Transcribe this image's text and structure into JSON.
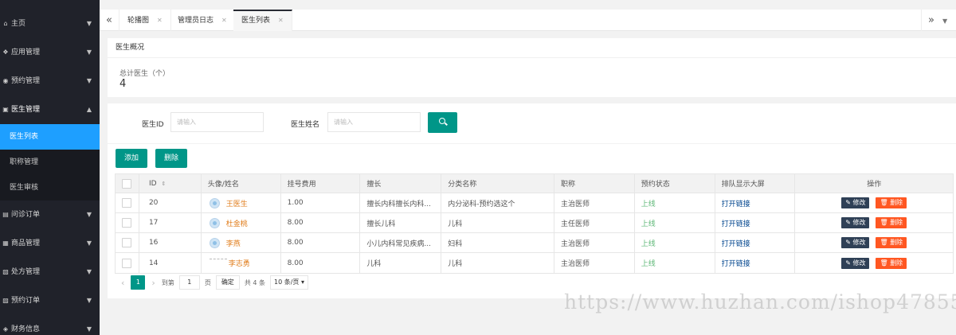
{
  "sidebar": {
    "items": [
      {
        "label": "主页",
        "icon": "home-icon",
        "glyph": "⌂"
      },
      {
        "label": "应用管理",
        "icon": "app-icon",
        "glyph": "❖"
      },
      {
        "label": "预约管理",
        "icon": "calendar-icon",
        "glyph": "◉"
      },
      {
        "label": "医生管理",
        "icon": "users-icon",
        "glyph": "▣"
      }
    ],
    "subitems": [
      {
        "label": "医生列表"
      },
      {
        "label": "职称管理"
      },
      {
        "label": "医生审核"
      }
    ],
    "items_after": [
      {
        "label": "问诊订单",
        "icon": "chat-icon",
        "glyph": "▤"
      },
      {
        "label": "商品管理",
        "icon": "goods-icon",
        "glyph": "▦"
      },
      {
        "label": "处方管理",
        "icon": "prescription-icon",
        "glyph": "▧"
      },
      {
        "label": "预约订单",
        "icon": "order-icon",
        "glyph": "▨"
      },
      {
        "label": "财务信息",
        "icon": "finance-icon",
        "glyph": "◈"
      }
    ]
  },
  "tabs": [
    {
      "label": "轮播图"
    },
    {
      "label": "管理员日志"
    },
    {
      "label": "医生列表"
    }
  ],
  "overview": {
    "title": "医生概况",
    "stat_label": "总计医生（个）",
    "stat_value": "4"
  },
  "search": {
    "id_label": "医生ID",
    "id_placeholder": "请输入",
    "name_label": "医生姓名",
    "name_placeholder": "请输入"
  },
  "toolbar": {
    "add_label": "添加",
    "delete_label": "删除"
  },
  "table": {
    "columns": [
      "ID",
      "头像/姓名",
      "挂号费用",
      "擅长",
      "分类名称",
      "职称",
      "预约状态",
      "排队显示大屏",
      "操作"
    ],
    "rows": [
      {
        "id": "20",
        "name": "王医生",
        "fee": "1.00",
        "specialty": "擅长内科擅长内科...",
        "category": "内分泌科-预约选这个",
        "title": "主治医师",
        "status": "上线",
        "link": "打开链接",
        "avatar": true
      },
      {
        "id": "17",
        "name": "杜金桃",
        "fee": "8.00",
        "specialty": "擅长儿科",
        "category": "儿科",
        "title": "主任医师",
        "status": "上线",
        "link": "打开链接",
        "avatar": true
      },
      {
        "id": "16",
        "name": "李燕",
        "fee": "8.00",
        "specialty": "小儿内科常见疾病...",
        "category": "妇科",
        "title": "主治医师",
        "status": "上线",
        "link": "打开链接",
        "avatar": true
      },
      {
        "id": "14",
        "name": "李志勇",
        "fee": "8.00",
        "specialty": "儿科",
        "category": "儿科",
        "title": "主治医师",
        "status": "上线",
        "link": "打开链接",
        "avatar": false
      }
    ],
    "edit_label": "✎ 修改",
    "del_label": "🗑 删除"
  },
  "pager": {
    "current": "1",
    "goto_label": "到第",
    "goto_value": "1",
    "page_unit": "页",
    "confirm": "确定",
    "total": "共 4 条",
    "limit": "10 条/页"
  },
  "watermark": "https://www.huzhan.com/ishop47855",
  "colors": {
    "sidebar_bg": "#20222a",
    "accent": "#1e9fff",
    "primary": "#009688",
    "danger": "#ff5722"
  }
}
